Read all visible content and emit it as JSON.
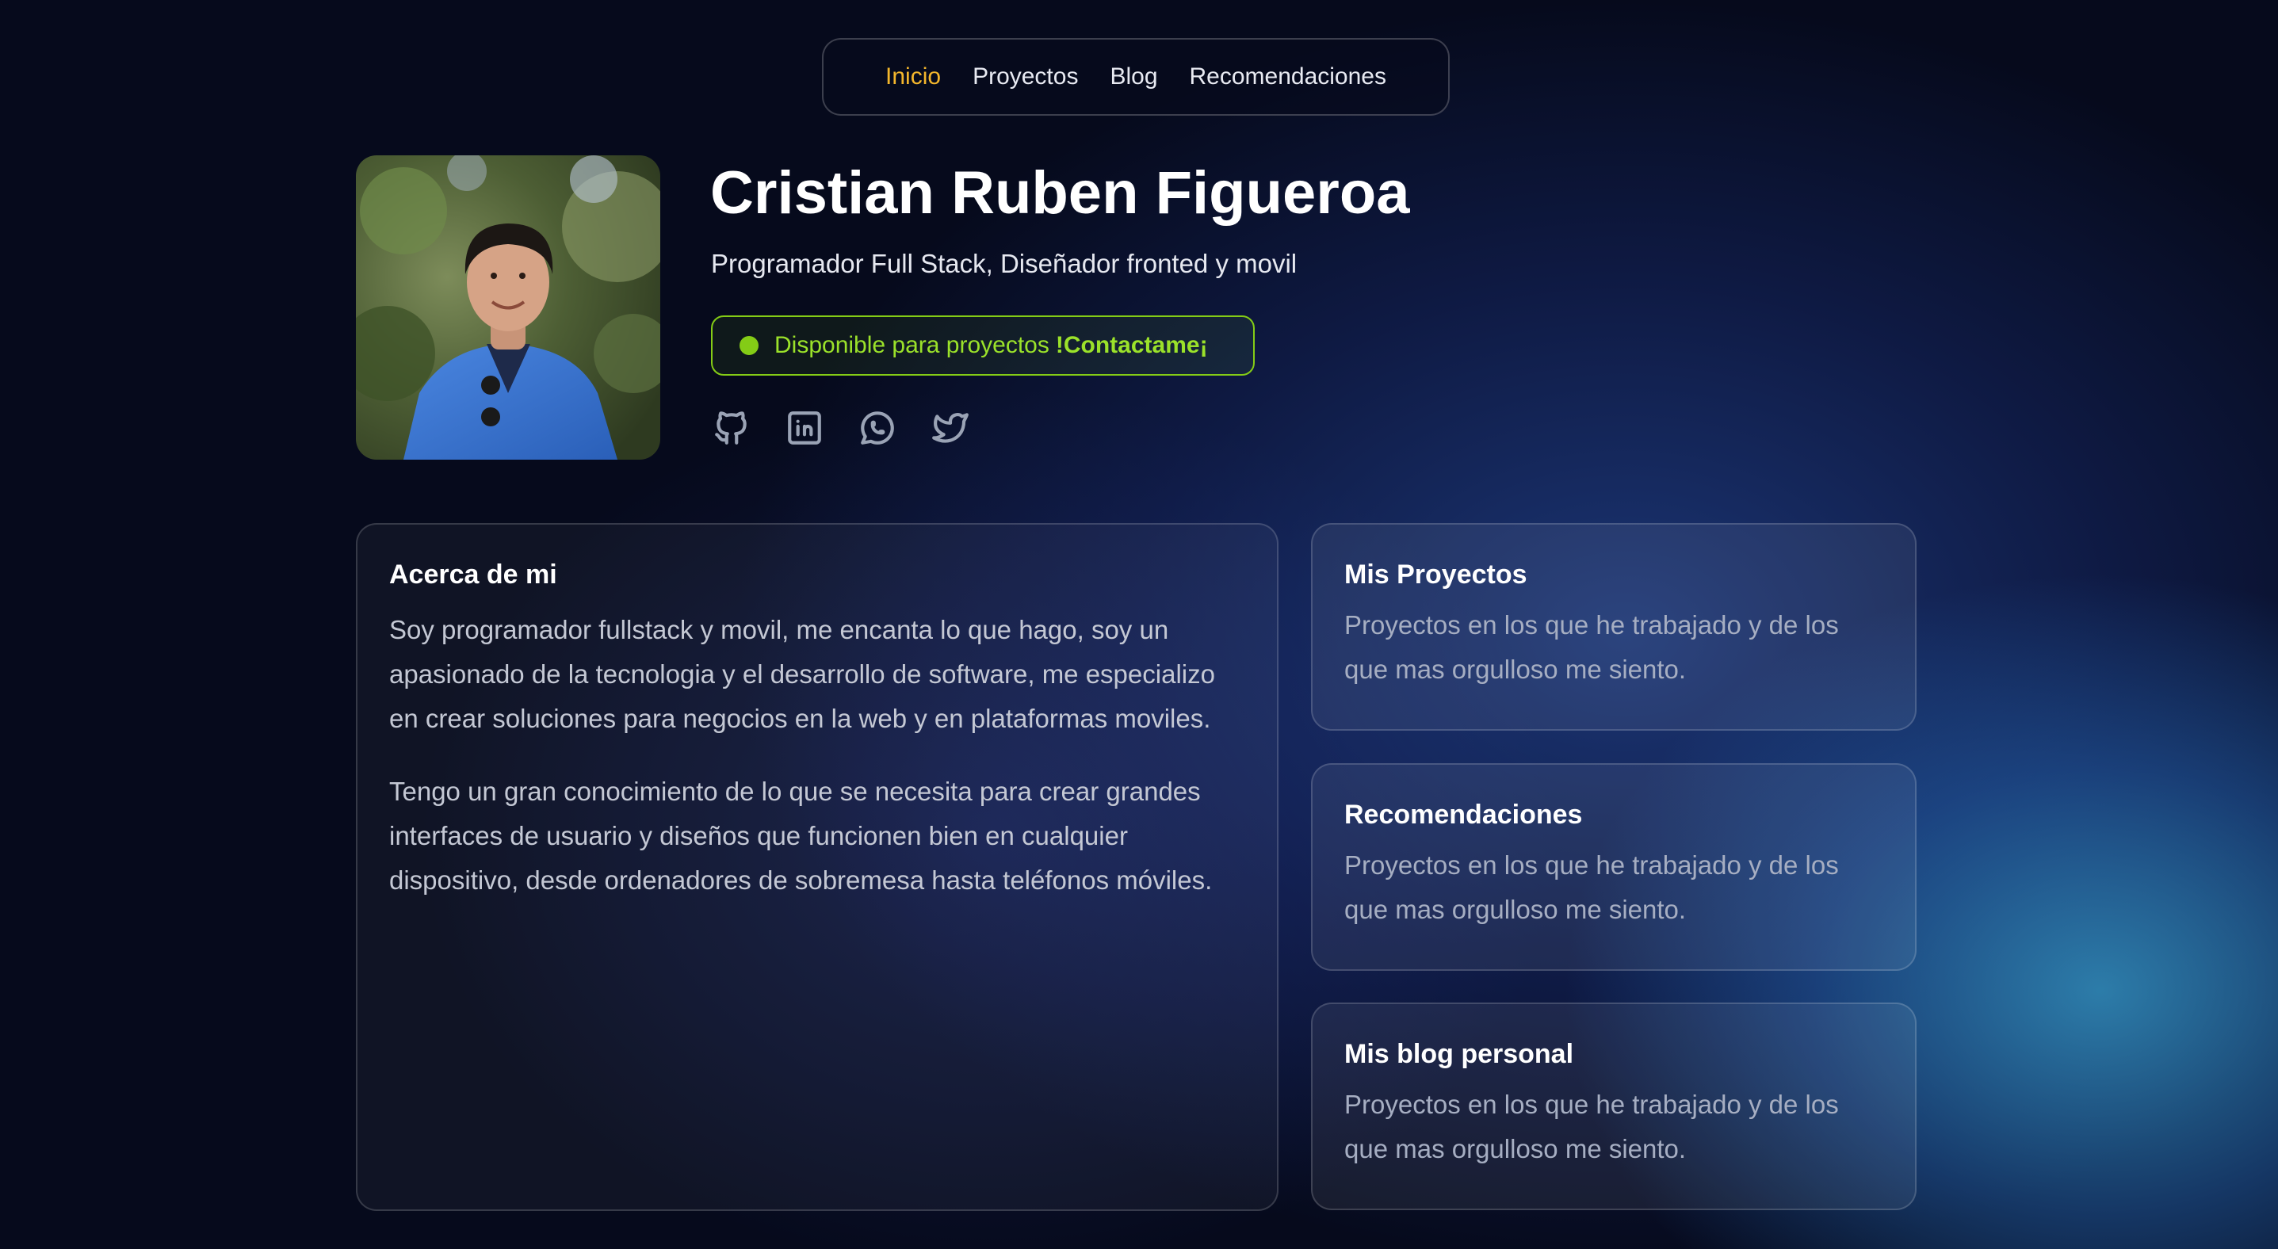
{
  "nav": {
    "items": [
      {
        "label": "Inicio",
        "active": true
      },
      {
        "label": "Proyectos",
        "active": false
      },
      {
        "label": "Blog",
        "active": false
      },
      {
        "label": "Recomendaciones",
        "active": false
      }
    ]
  },
  "profile": {
    "name": "Cristian Ruben Figueroa",
    "tagline": "Programador Full Stack, Diseñador fronted y movil",
    "status_text": "Disponible para proyectos",
    "status_cta": "!Contactame¡",
    "socials": [
      "github-icon",
      "linkedin-icon",
      "whatsapp-icon",
      "twitter-icon"
    ]
  },
  "about": {
    "title": "Acerca de mi",
    "paragraphs": [
      "Soy programador fullstack y movil, me encanta lo que hago, soy un apasionado de la tecnologia y el desarrollo de software, me especializo en crear soluciones para negocios en la web y en plataformas moviles.",
      "Tengo un gran conocimiento de lo que se necesita para crear grandes interfaces de usuario y diseños que funcionen bien en cualquier dispositivo, desde ordenadores de sobremesa hasta teléfonos móviles."
    ]
  },
  "cards": [
    {
      "title": "Mis Proyectos",
      "description": "Proyectos en los que he trabajado y de los que mas orgulloso me siento."
    },
    {
      "title": "Recomendaciones",
      "description": "Proyectos en los que he trabajado y de los que mas orgulloso me siento."
    },
    {
      "title": "Mis blog personal",
      "description": "Proyectos en los que he trabajado y de los que mas orgulloso me siento."
    }
  ],
  "colors": {
    "accent_active": "#f3b62c",
    "status_green": "#84cc16",
    "background": "#060a1c",
    "icon_gray": "#9aa3b5"
  }
}
